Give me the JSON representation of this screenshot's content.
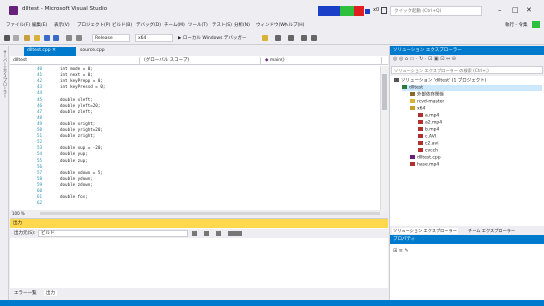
{
  "window": {
    "title": "dlltest - Microsoft Visual Studio",
    "debug_indicator": "x0",
    "quick_launch_placeholder": "クイック起動 (Ctrl+Q)",
    "run_label": "執行 - 令集"
  },
  "colors": {
    "accent": "#007acc",
    "vs_purple": "#68217a",
    "bar_blue": "#1b3fc7",
    "bar_green": "#2fbf3f",
    "bar_red": "#e02020",
    "output_header": "#ffd84d"
  },
  "menu": [
    "ファイル(F)",
    "編集(E)",
    "表示(V)",
    "プロジェクト(P)",
    "ビルド(B)",
    "デバッグ(D)",
    "チーム(M)",
    "ツール(T)",
    "テスト(S)",
    "分析(N)",
    "ウィンドウ(W)",
    "ヘルプ(H)"
  ],
  "toolbar": {
    "config": "Release",
    "platform": "x64",
    "run_target": "▶ ローカル Windows デバッガー"
  },
  "left_strip_label": "サーバーエクスプローラー",
  "editor": {
    "tab_active": "dlltest.cpp",
    "tab_inactive": "source.cpp",
    "nav_scope": "dlltest",
    "nav_global": "(グローバル スコープ)",
    "nav_func": "main()",
    "zoom": "100 %",
    "lines": [
      {
        "n": "40",
        "code": "int mode = 0;"
      },
      {
        "n": "41",
        "code": "int next = 0;"
      },
      {
        "n": "42",
        "code": "int keyPrepp = 0;"
      },
      {
        "n": "43",
        "code": "int keyPressd = 0;"
      },
      {
        "n": "44",
        "code": ""
      },
      {
        "n": "45",
        "code": "double xleft;"
      },
      {
        "n": "46",
        "code": "double yleft=20;"
      },
      {
        "n": "47",
        "code": "double zleft;"
      },
      {
        "n": "48",
        "code": ""
      },
      {
        "n": "49",
        "code": "double xright;"
      },
      {
        "n": "50",
        "code": "double yright=20;"
      },
      {
        "n": "51",
        "code": "double zright;"
      },
      {
        "n": "52",
        "code": ""
      },
      {
        "n": "53",
        "code": "double xup = -20;"
      },
      {
        "n": "54",
        "code": "double yup;"
      },
      {
        "n": "55",
        "code": "double zup;"
      },
      {
        "n": "56",
        "code": ""
      },
      {
        "n": "57",
        "code": "double xdown = 5;"
      },
      {
        "n": "58",
        "code": "double ydown;"
      },
      {
        "n": "59",
        "code": "double zdown;"
      },
      {
        "n": "60",
        "code": ""
      },
      {
        "n": "61",
        "code": "double fos;"
      },
      {
        "n": "62",
        "code": ""
      }
    ]
  },
  "output": {
    "title": "出力",
    "source_label": "出力元(S):",
    "source_value": "ビルド"
  },
  "bottom_tabs": [
    "エラー一覧",
    "出力"
  ],
  "solution_explorer": {
    "title": "ソリューション エクスプローラー",
    "search_placeholder": "ソリューション エクスプローラー の検索 (Ctrl+;)",
    "items": [
      {
        "label": "ソリューション 'dlltest' (1 プロジェクト)",
        "indent": 0
      },
      {
        "label": "dlltest",
        "indent": 1
      },
      {
        "label": "外部依存関係",
        "indent": 2
      },
      {
        "label": "rcvd-master",
        "indent": 2
      },
      {
        "label": "x64",
        "indent": 2
      },
      {
        "label": "a.mp4",
        "indent": 3
      },
      {
        "label": "a2.mp4",
        "indent": 3
      },
      {
        "label": "b.mp4",
        "indent": 3
      },
      {
        "label": "c.AVI",
        "indent": 3
      },
      {
        "label": "c2.avi",
        "indent": 3
      },
      {
        "label": "cvcch",
        "indent": 3
      },
      {
        "label": "dlltest.cpp",
        "indent": 2
      },
      {
        "label": "hase.mp4",
        "indent": 2
      }
    ],
    "tab_a": "ソリューション エクスプローラー",
    "tab_b": "チーム エクスプローラー"
  },
  "properties": {
    "title": "プロパティ"
  }
}
